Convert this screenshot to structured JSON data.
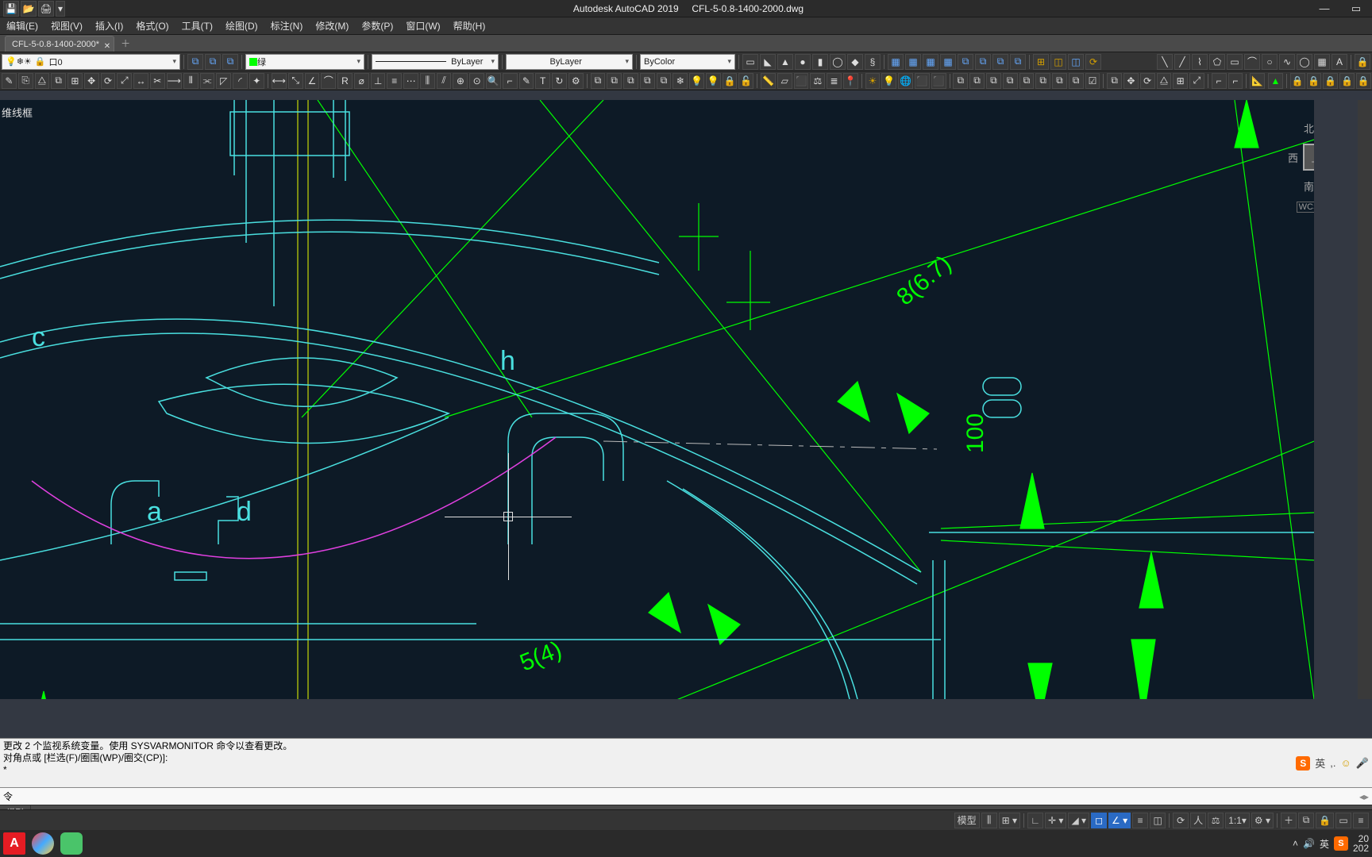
{
  "titlebar": {
    "app": "Autodesk AutoCAD 2019",
    "file": "CFL-5-0.8-1400-2000.dwg"
  },
  "menu": [
    "编辑(E)",
    "视图(V)",
    "插入(I)",
    "格式(O)",
    "工具(T)",
    "绘图(D)",
    "标注(N)",
    "修改(M)",
    "参数(P)",
    "窗口(W)",
    "帮助(H)"
  ],
  "tabs": {
    "active": "CFL-5-0.8-1400-2000*"
  },
  "props": {
    "layer_prefix": "口0",
    "color_label": "绿",
    "linetype": "ByLayer",
    "lineweight": "ByLayer",
    "plotstyle": "ByColor"
  },
  "viewport": {
    "label": "维线框"
  },
  "nav": {
    "north": "北",
    "west": "西",
    "south": "南",
    "top": "上",
    "wcs": "WCS"
  },
  "annot": {
    "a": "c",
    "b": "h",
    "c": "a",
    "d": "d",
    "dim1": "8(6.7)",
    "dim2": "100",
    "dim3": "5(4)"
  },
  "cmd": {
    "l1": "更改 2 个监视系统变量。使用 SYSVARMONITOR 命令以查看更改。",
    "l2": "对角点或 [栏选(F)/圈围(WP)/圈交(CP)]:",
    "l3": "*",
    "input": "令"
  },
  "ime": {
    "lang": "英",
    "sep": ",."
  },
  "bottabs": {
    "model": "模型"
  },
  "status": {
    "model": "模型",
    "scale": "1:1"
  },
  "tray": {
    "lang": "英",
    "date": "20",
    "year": "202"
  }
}
